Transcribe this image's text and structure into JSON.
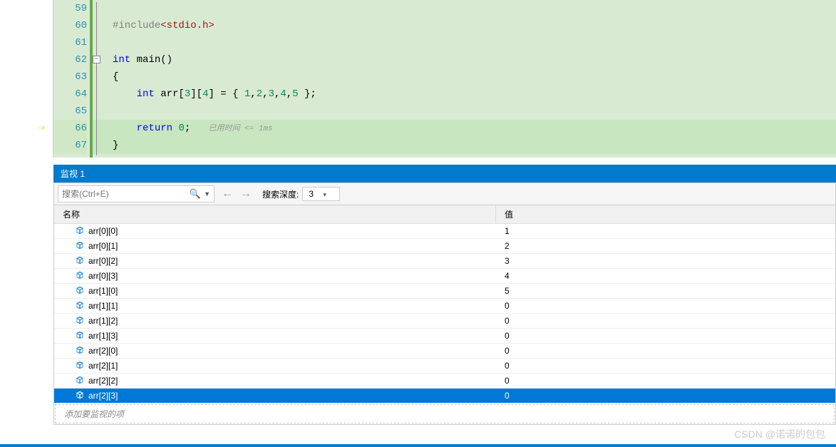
{
  "editor": {
    "lines": [
      {
        "num": "59",
        "html": ""
      },
      {
        "num": "60",
        "html": "<span class='kw-gray'>#include</span><span class='kw-red'>&lt;stdio.h&gt;</span>"
      },
      {
        "num": "61",
        "html": ""
      },
      {
        "num": "62",
        "html": "<span class='kw-blue'>int</span> <span style='color:#000'>main</span>()",
        "fold": true
      },
      {
        "num": "63",
        "html": "{"
      },
      {
        "num": "64",
        "html": "    <span class='kw-blue'>int</span> arr[<span class='num'>3</span>][<span class='num'>4</span>] = { <span class='num'>1</span>,<span class='num'>2</span>,<span class='num'>3</span>,<span class='num'>4</span>,<span class='num'>5</span> };"
      },
      {
        "num": "65",
        "html": ""
      },
      {
        "num": "66",
        "html": "    <span class='kw-blue'>return</span> <span class='num'>0</span>;   <span class='hint'>已用时间 &lt;= 1ms</span>",
        "highlight": true
      },
      {
        "num": "67",
        "html": "}",
        "highlight": true
      }
    ],
    "breakpoint_line": "66"
  },
  "panel": {
    "title": "监视 1",
    "search_placeholder": "搜索(Ctrl+E)",
    "depth_label": "搜索深度:",
    "depth_value": "3"
  },
  "table": {
    "header_name": "名称",
    "header_value": "值",
    "rows": [
      {
        "name": "arr[0][0]",
        "value": "1"
      },
      {
        "name": "arr[0][1]",
        "value": "2"
      },
      {
        "name": "arr[0][2]",
        "value": "3"
      },
      {
        "name": "arr[0][3]",
        "value": "4"
      },
      {
        "name": "arr[1][0]",
        "value": "5"
      },
      {
        "name": "arr[1][1]",
        "value": "0"
      },
      {
        "name": "arr[1][2]",
        "value": "0"
      },
      {
        "name": "arr[1][3]",
        "value": "0"
      },
      {
        "name": "arr[2][0]",
        "value": "0"
      },
      {
        "name": "arr[2][1]",
        "value": "0"
      },
      {
        "name": "arr[2][2]",
        "value": "0"
      },
      {
        "name": "arr[2][3]",
        "value": "0",
        "selected": true
      }
    ],
    "add_item_text": "添加要监视的项"
  },
  "watermark": "CSDN @诺诺的包包"
}
